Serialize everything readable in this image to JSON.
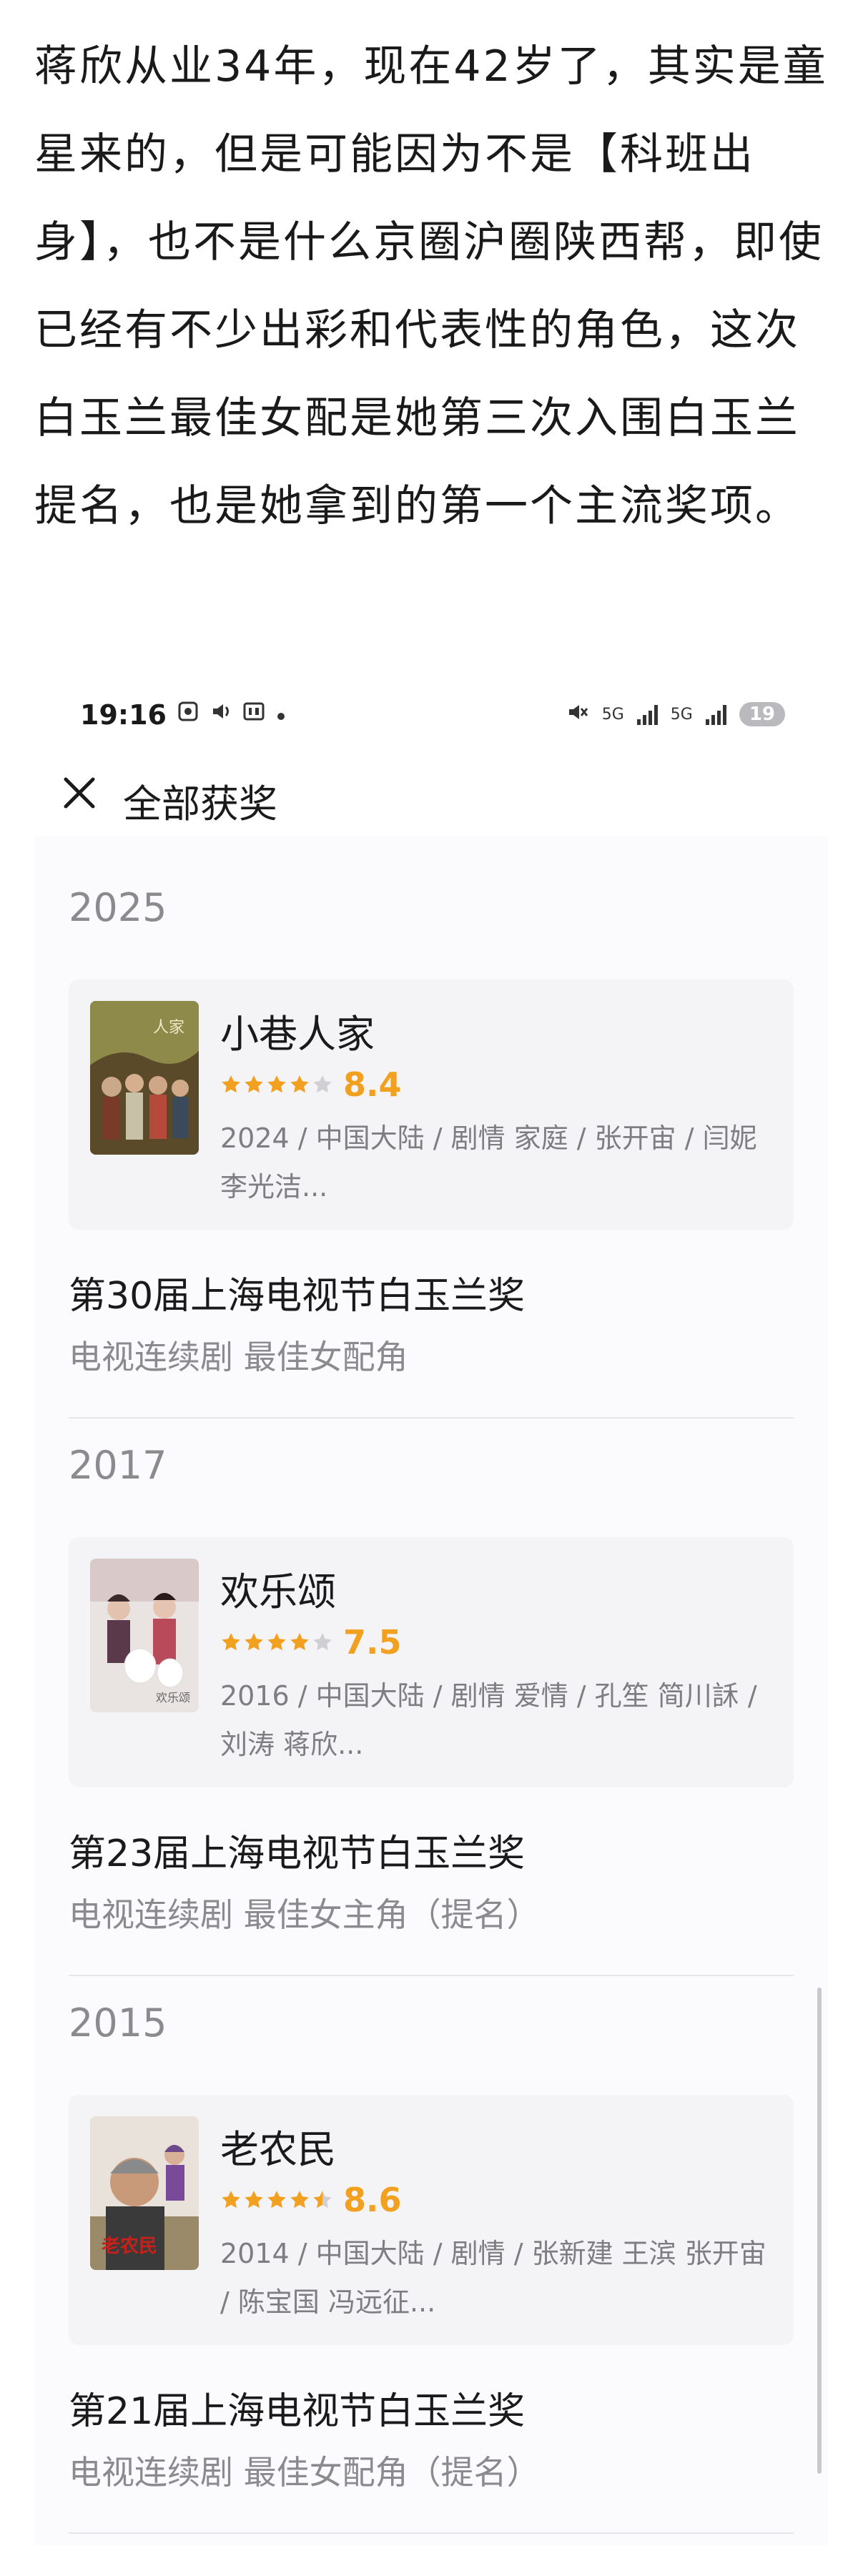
{
  "article": {
    "text": "蒋欣从业34年，现在42岁了，其实是童星来的，但是可能因为不是【科班出身】，也不是什么京圈沪圈陕西帮，即使已经有不少出彩和代表性的角色，这次白玉兰最佳女配是她第三次入围白玉兰提名，也是她拿到的第一个主流奖项。"
  },
  "status_bar": {
    "time": "19:16",
    "left_icons": [
      "screen-record-icon",
      "volume-icon",
      "hd-icon",
      "dot-icon"
    ],
    "net1": "5G",
    "net2": "5G",
    "battery": "19"
  },
  "nav": {
    "title": "全部获奖",
    "close_icon": "close-icon"
  },
  "awards": [
    {
      "year": "2025",
      "work": {
        "title": "小巷人家",
        "rating": 8.4,
        "stars": 4,
        "meta": "2024 / 中国大陆 / 剧情 家庭 / 张开宙 / 闫妮 李光洁..."
      },
      "award_name": "第30届上海电视节白玉兰奖",
      "category": "电视连续剧 最佳女配角"
    },
    {
      "year": "2017",
      "work": {
        "title": "欢乐颂",
        "rating": 7.5,
        "stars": 4,
        "meta": "2016 / 中国大陆 / 剧情 爱情 / 孔笙 简川訸 / 刘涛 蒋欣..."
      },
      "award_name": "第23届上海电视节白玉兰奖",
      "category": "电视连续剧 最佳女主角（提名）"
    },
    {
      "year": "2015",
      "work": {
        "title": "老农民",
        "rating": 8.6,
        "stars": 4.5,
        "meta": "2014 / 中国大陆 / 剧情 / 张新建 王滨 张开宙 / 陈宝国 冯远征..."
      },
      "award_name": "第21届上海电视节白玉兰奖",
      "category": "电视连续剧 最佳女配角（提名）"
    }
  ],
  "colors": {
    "star": "#f2a01f",
    "star_empty": "#d0d0d4",
    "secondary_text": "#8a8a8f"
  }
}
